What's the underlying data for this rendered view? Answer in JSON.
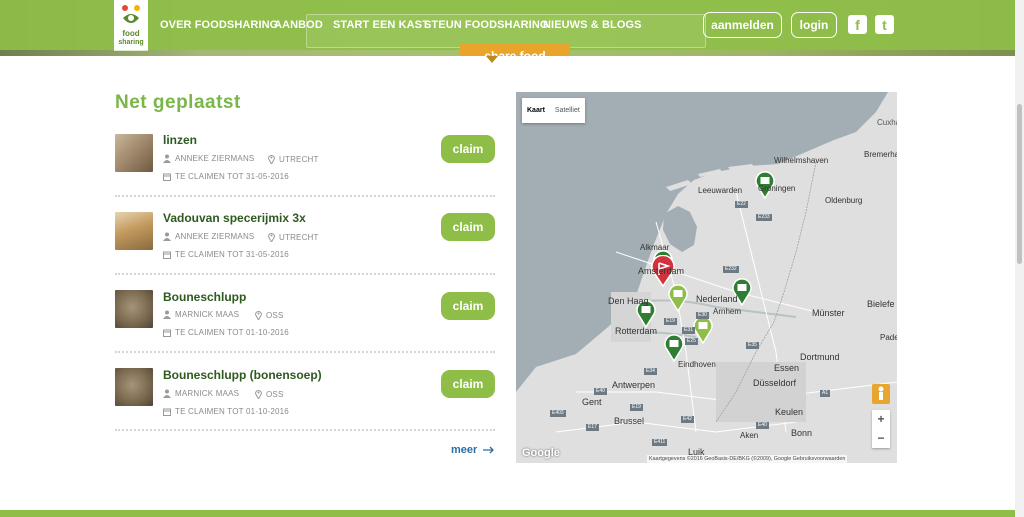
{
  "header": {
    "logo_text_line1": "food",
    "logo_text_line2": "sharing",
    "nav": [
      {
        "label": "OVER FOODSHARING"
      },
      {
        "label": "AANBOD"
      },
      {
        "label": "START EEN KAST"
      },
      {
        "label": "STEUN FOODSHARING"
      },
      {
        "label": "NIEUWS & BLOGS"
      }
    ],
    "aanmelden_label": "aanmelden",
    "login_label": "login",
    "facebook_glyph": "f",
    "twitter_glyph": "t",
    "slogan": "share food"
  },
  "section": {
    "title": "Net geplaatst",
    "more_label": "meer"
  },
  "items": [
    {
      "title": "linzen",
      "user": "ANNEKE ZIERMANS",
      "location": "UTRECHT",
      "deadline": "TE CLAIMEN TOT 31-05-2016",
      "claim_label": "claim",
      "thumb_color": "#b59c7e"
    },
    {
      "title": "Vadouvan specerijmix 3x",
      "user": "ANNEKE ZIERMANS",
      "location": "UTRECHT",
      "deadline": "TE CLAIMEN TOT 31-05-2016",
      "claim_label": "claim",
      "thumb_color": "#c8a470"
    },
    {
      "title": "Bouneschlupp",
      "user": "MARNICK MAAS",
      "location": "OSS",
      "deadline": "TE CLAIMEN TOT 01-10-2016",
      "claim_label": "claim",
      "thumb_color": "#8b7a5e"
    },
    {
      "title": "Bouneschlupp (bonensoep)",
      "user": "MARNICK MAAS",
      "location": "OSS",
      "deadline": "TE CLAIMEN TOT 01-10-2016",
      "claim_label": "claim",
      "thumb_color": "#8b7a5e"
    }
  ],
  "map": {
    "type_map": "Kaart",
    "type_satellite": "Satelliet",
    "labels": {
      "cuxha": "Cuxha",
      "bremerha": "Bremerha",
      "wilhelmshaven": "Wilhelmshaven",
      "leeuwarden": "Leeuwarden",
      "groningen": "Groningen",
      "oldenburg": "Oldenburg",
      "alkmaar": "Alkmaar",
      "amsterdam": "Amsterdam",
      "nederland": "Nederland",
      "den_haag": "Den Haag",
      "arnhem": "Arnhem",
      "munster": "Münster",
      "bielefe": "Bielefe",
      "rotterdam": "Rotterdam",
      "dortmund": "Dortmund",
      "pade": "Pade",
      "eindhoven": "Eindhoven",
      "essen": "Essen",
      "antwerpen": "Antwerpen",
      "gent": "Gent",
      "dusseldorf": "Düsseldorf",
      "brussel": "Brussel",
      "keulen": "Keulen",
      "aken": "Aken",
      "bonn": "Bonn",
      "luik": "Luik"
    },
    "roads": [
      "E22",
      "E233",
      "E232",
      "E30",
      "E19",
      "E25",
      "E31",
      "E35",
      "E34",
      "E40",
      "E403",
      "E17",
      "E42",
      "E411",
      "E19",
      "E40",
      "A1"
    ],
    "zoom_in": "+",
    "zoom_out": "−",
    "google": "Google",
    "attribution": "Kaartgegevens ©2016 GeoBasis-DE/BKG (©2009), Google   Gebruiksvoorwaarden"
  }
}
